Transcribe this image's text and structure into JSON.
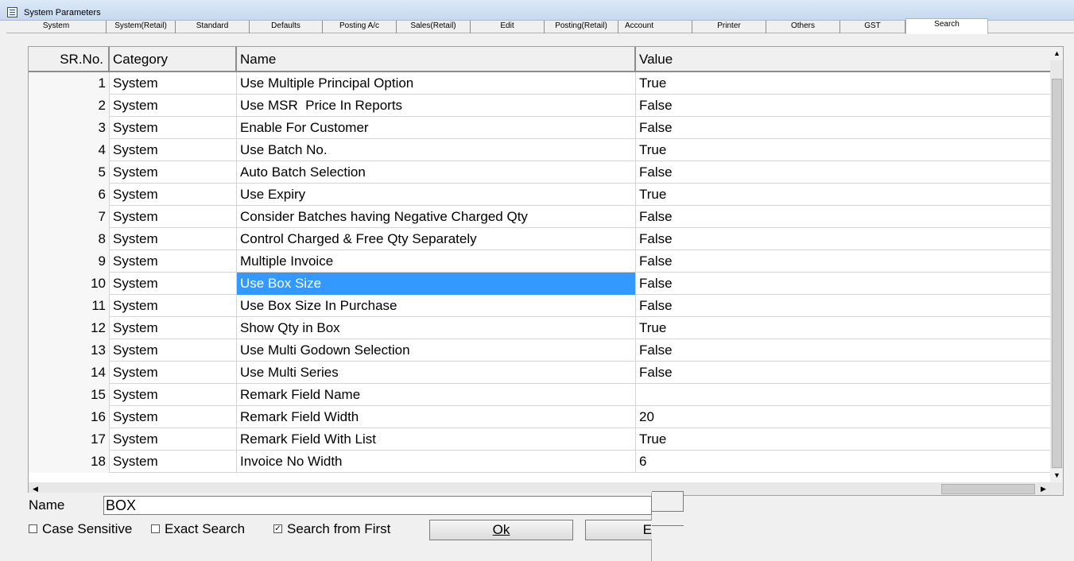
{
  "window": {
    "title": "System Parameters"
  },
  "tabs": [
    {
      "label": "System",
      "active": false
    },
    {
      "label": "System(Retail)",
      "active": false
    },
    {
      "label": "Standard",
      "active": false
    },
    {
      "label": "Defaults",
      "active": false
    },
    {
      "label": "Posting A/c",
      "active": false
    },
    {
      "label": "Sales(Retail)",
      "active": false
    },
    {
      "label": "Edit",
      "active": false
    },
    {
      "label": "Posting(Retail)",
      "active": false
    },
    {
      "label": "Account",
      "active": false
    },
    {
      "label": "Printer",
      "active": false
    },
    {
      "label": "Others",
      "active": false
    },
    {
      "label": "GST",
      "active": false
    },
    {
      "label": "Search",
      "active": true
    }
  ],
  "grid": {
    "columns": [
      "SR.No.",
      "Category",
      "Name",
      "Value"
    ],
    "selected_row": 10,
    "rows": [
      {
        "sr": "1",
        "category": "System",
        "name": "Use Multiple Principal Option",
        "value": "True"
      },
      {
        "sr": "2",
        "category": "System",
        "name": "Use MSR  Price In Reports",
        "value": "False"
      },
      {
        "sr": "3",
        "category": "System",
        "name": "Enable For Customer",
        "value": "False"
      },
      {
        "sr": "4",
        "category": "System",
        "name": "Use Batch No.",
        "value": "True"
      },
      {
        "sr": "5",
        "category": "System",
        "name": "Auto Batch Selection",
        "value": "False"
      },
      {
        "sr": "6",
        "category": "System",
        "name": "Use Expiry",
        "value": "True"
      },
      {
        "sr": "7",
        "category": "System",
        "name": "Consider Batches having Negative Charged Qty",
        "value": "False"
      },
      {
        "sr": "8",
        "category": "System",
        "name": "Control Charged & Free Qty Separately",
        "value": "False"
      },
      {
        "sr": "9",
        "category": "System",
        "name": "Multiple Invoice",
        "value": "False"
      },
      {
        "sr": "10",
        "category": "System",
        "name": "Use Box Size",
        "value": "False"
      },
      {
        "sr": "11",
        "category": "System",
        "name": "Use Box Size In Purchase",
        "value": "False"
      },
      {
        "sr": "12",
        "category": "System",
        "name": "Show Qty in Box",
        "value": "True"
      },
      {
        "sr": "13",
        "category": "System",
        "name": "Use Multi Godown Selection",
        "value": "False"
      },
      {
        "sr": "14",
        "category": "System",
        "name": "Use Multi Series",
        "value": "False"
      },
      {
        "sr": "15",
        "category": "System",
        "name": "Remark Field Name",
        "value": ""
      },
      {
        "sr": "16",
        "category": "System",
        "name": "Remark Field Width",
        "value": "20"
      },
      {
        "sr": "17",
        "category": "System",
        "name": "Remark Field With List",
        "value": "True"
      },
      {
        "sr": "18",
        "category": "System",
        "name": "Invoice No Width",
        "value": "6"
      }
    ]
  },
  "search": {
    "name_label": "Name",
    "name_value": "BOX",
    "case_sensitive": {
      "label": "Case Sensitive",
      "checked": false
    },
    "exact_search": {
      "label": "Exact Search",
      "checked": false
    },
    "search_from_first": {
      "label": "Search from First",
      "checked": true
    },
    "ok_label": "Ok",
    "exit_label": "E"
  },
  "colors": {
    "selection": "#3399ff",
    "titlebar": "#dce9f7"
  }
}
